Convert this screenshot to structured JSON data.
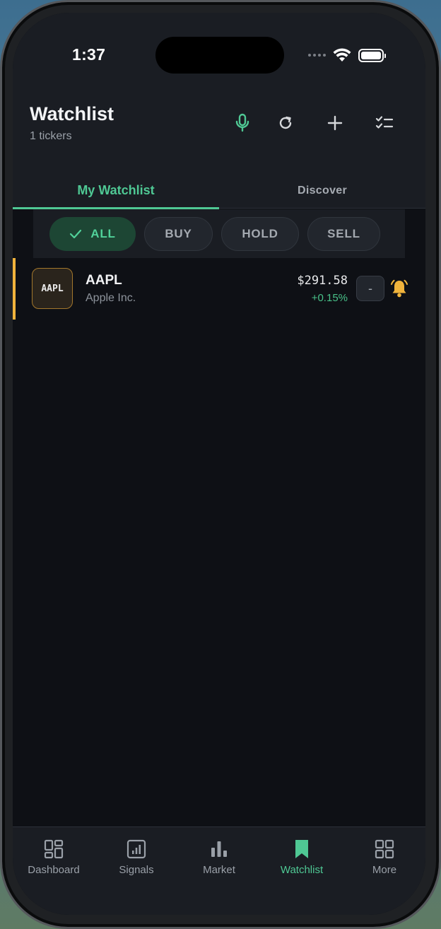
{
  "status_bar": {
    "time": "1:37"
  },
  "header": {
    "title": "Watchlist",
    "subtitle": "1 tickers",
    "icons": [
      "microphone-icon",
      "refresh-icon",
      "plus-icon",
      "checklist-icon"
    ]
  },
  "tabs": [
    {
      "label": "My Watchlist",
      "active": true
    },
    {
      "label": "Discover",
      "active": false
    }
  ],
  "filters": [
    {
      "label": "ALL",
      "active": true
    },
    {
      "label": "BUY",
      "active": false
    },
    {
      "label": "HOLD",
      "active": false
    },
    {
      "label": "SELL",
      "active": false
    }
  ],
  "watchlist": [
    {
      "logo_text": "AAPL",
      "symbol": "AAPL",
      "name": "Apple Inc.",
      "price": "$291.58",
      "change": "+0.15%",
      "remove_label": "-"
    }
  ],
  "bottom_nav": [
    {
      "label": "Dashboard",
      "icon": "dashboard-icon",
      "active": false
    },
    {
      "label": "Signals",
      "icon": "signals-icon",
      "active": false
    },
    {
      "label": "Market",
      "icon": "market-icon",
      "active": false
    },
    {
      "label": "Watchlist",
      "icon": "bookmark-icon",
      "active": true
    },
    {
      "label": "More",
      "icon": "grid-icon",
      "active": false
    }
  ],
  "colors": {
    "accent": "#4fc894",
    "hold_accent": "#f1b43c",
    "background": "#0e1015",
    "surface": "#1a1d23"
  }
}
